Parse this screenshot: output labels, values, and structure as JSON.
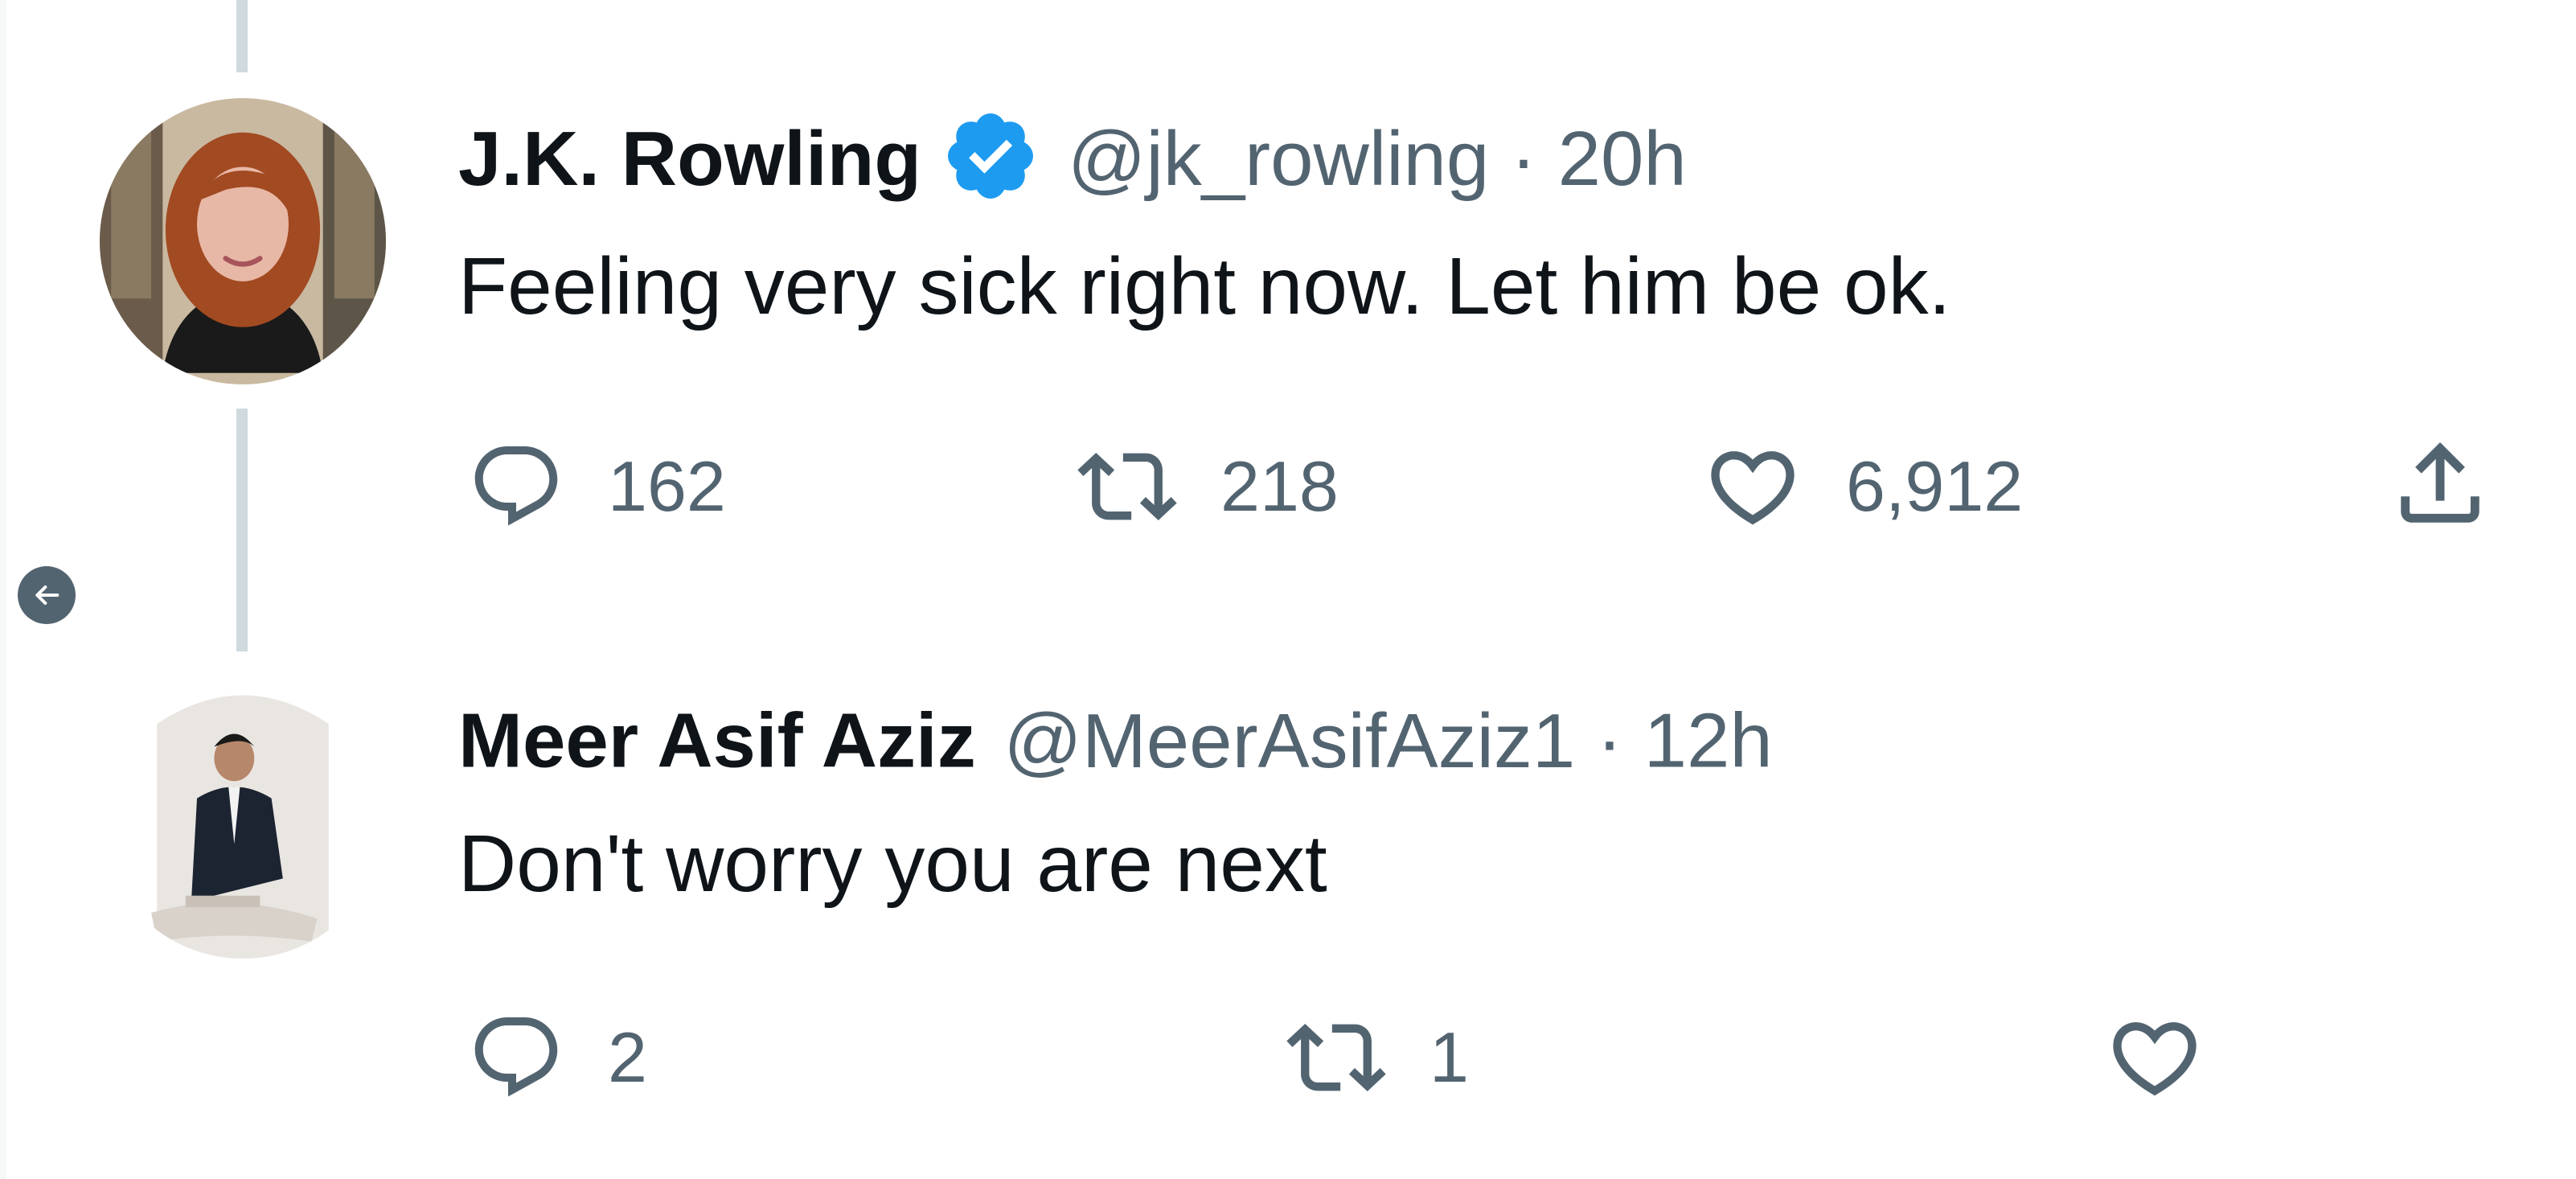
{
  "tweets": [
    {
      "name": "J.K. Rowling",
      "verified": true,
      "handle": "@jk_rowling",
      "separator": "·",
      "time": "20h",
      "text": "Feeling very sick right now. Let him be ok.",
      "actions": {
        "reply_count": "162",
        "retweet_count": "218",
        "like_count": "6,912"
      }
    },
    {
      "name": "Meer Asif Aziz",
      "verified": false,
      "handle": "@MeerAsifAziz1",
      "separator": "·",
      "time": "12h",
      "text": "Don't worry you are next",
      "actions": {
        "reply_count": "2",
        "retweet_count": "1"
      }
    }
  ],
  "icons": {
    "reply": "reply-icon",
    "retweet": "retweet-icon",
    "like": "heart-icon",
    "share": "share-icon",
    "verified": "verified-badge-icon",
    "back": "arrow-left-icon"
  },
  "colors": {
    "verified": "#1d9bf0",
    "muted_text": "#536471",
    "thread_line": "#cfd9de"
  }
}
